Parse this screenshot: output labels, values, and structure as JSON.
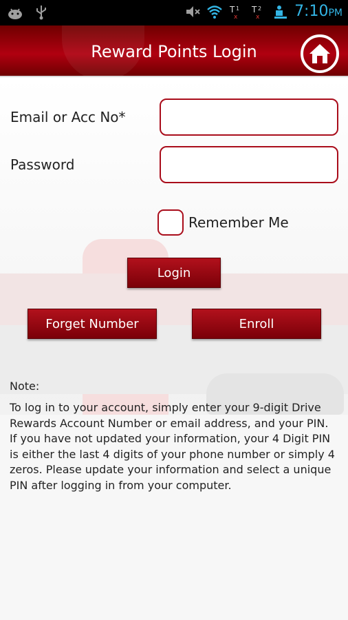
{
  "status_bar": {
    "left_icons": [
      "android-icon",
      "usb-icon"
    ],
    "right_icons": [
      "mute-icon",
      "wifi-icon",
      "signal-1-icon",
      "signal-2-icon",
      "download-icon"
    ],
    "time": "7:10",
    "ampm": "PM",
    "time_color": "#33b5e5"
  },
  "header": {
    "title": "Reward Points Login",
    "home_icon": "home-icon",
    "background_color": "#b00010"
  },
  "form": {
    "email_label": "Email or Acc No*",
    "email_value": "",
    "password_label": "Password",
    "password_value": "",
    "remember_label": "Remember Me",
    "remember_checked": false,
    "login_label": "Login",
    "forget_label": "Forget Number",
    "enroll_label": "Enroll",
    "accent_color": "#a90c1a"
  },
  "note": {
    "title": "Note:",
    "text": "To log in to your account, simply enter your 9-digit Drive Rewards Account Number or email address, and your PIN. If you have not updated your information, your 4 Digit PIN is either the last 4 digits of your phone number or simply 4 zeros. Please update your information and select a unique PIN after logging in from your computer."
  }
}
